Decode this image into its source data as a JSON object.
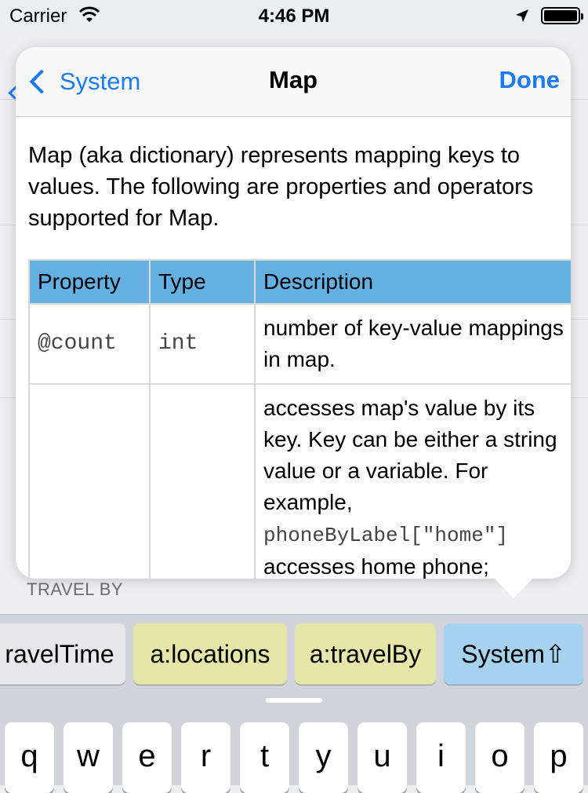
{
  "status_bar": {
    "carrier": "Carrier",
    "time": "4:46 PM"
  },
  "popover": {
    "back_label": "System",
    "title": "Map",
    "done_label": "Done",
    "intro": "Map (aka dictionary) represents mapping keys to values. The following are properties and operators supported for Map.",
    "table": {
      "headers": [
        "Property",
        "Type",
        "Description"
      ],
      "rows": [
        {
          "property": "@count",
          "type": "int",
          "description": "number of key-value mappings in map."
        },
        {
          "property": "",
          "type": "",
          "description_before": "accesses map's value by its key. Key can be either a string value or a variable. For example,",
          "description_code": "phoneByLabel[\"home\"]",
          "description_after": "accesses home phone;"
        }
      ],
      "header_color": "#64b0e0"
    }
  },
  "section_header": "TRAVEL BY",
  "suggestions": [
    {
      "label": "ravelTime",
      "color": "#e8e8ea"
    },
    {
      "label": "a:locations",
      "color": "#e5e6a8"
    },
    {
      "label": "a:travelBy",
      "color": "#e5e6a8"
    },
    {
      "label": "System⇧",
      "color": "#a5d2ee"
    }
  ],
  "keyboard": {
    "row1": [
      "q",
      "w",
      "e",
      "r",
      "t",
      "y",
      "u",
      "i",
      "o",
      "p"
    ]
  },
  "accent_color": "#1a7cf5"
}
